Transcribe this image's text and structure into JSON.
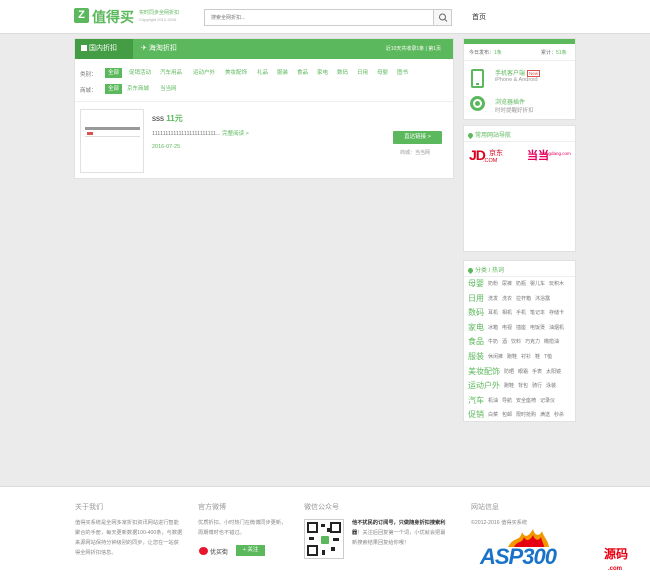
{
  "header": {
    "logo_letter": "Z",
    "logo_text": "值得买",
    "slogan": "实时同步全网折扣",
    "url": "Copyright 2012-2016",
    "search_placeholder": "搜索全网折扣...",
    "home": "首页"
  },
  "tabs": {
    "domestic": "国内折扣",
    "overseas": "海淘折扣",
    "meta": "近10天共收录1条 | 第1页"
  },
  "filters": {
    "category_label": "类别：",
    "categories": [
      "全部",
      "促销活动",
      "汽车用品",
      "运动户外",
      "美妆配饰",
      "礼品",
      "服装",
      "食品",
      "家电",
      "数码",
      "日用",
      "母婴",
      "图书"
    ],
    "mall_label": "商城：",
    "malls": [
      "全部",
      "京东商城",
      "当当网"
    ]
  },
  "item": {
    "title": "sss",
    "price": "11元",
    "desc": "111111111111111111111111...",
    "more": "完整阅读 >",
    "date": "2016-07-25",
    "buy": "直达链接 >",
    "mall": "商城：当当网"
  },
  "sidebar": {
    "stat_today": "今日发布：",
    "stat_today_val": "1条",
    "stat_total": "累计：",
    "stat_total_val": "51条",
    "mobile_title": "手机客户端",
    "mobile_badge": "New",
    "mobile_sub": "iPhone & Android",
    "plugin_title": "浏览器插件",
    "plugin_sub": "时时提醒好折扣",
    "nav_heading": "常用网站导航",
    "jd_logo": "JD",
    "jd_cn": "京东",
    "jd_sub": ".COM",
    "dd_logo": "当当",
    "dd_sub": "dangdang.com",
    "cat_heading": "分类 / 热词",
    "cats": [
      {
        "name": "母婴",
        "subs": [
          "奶粉",
          "尿裤",
          "奶瓶",
          "婴儿车",
          "玩积木"
        ]
      },
      {
        "name": "日用",
        "subs": [
          "洗发",
          "洗衣",
          "拉杆箱",
          "沐浴露"
        ]
      },
      {
        "name": "数码",
        "subs": [
          "耳机",
          "相机",
          "手机",
          "笔记本",
          "存储卡"
        ]
      },
      {
        "name": "家电",
        "subs": [
          "冰箱",
          "电视",
          "插座",
          "电饭煲",
          "油烟机"
        ]
      },
      {
        "name": "食品",
        "subs": [
          "牛奶",
          "酒",
          "饮料",
          "巧克力",
          "橄榄油"
        ]
      },
      {
        "name": "服装",
        "subs": [
          "休闲裤",
          "跑鞋",
          "衬衫",
          "鞋",
          "T恤"
        ]
      },
      {
        "name": "美妆配饰",
        "subs": [
          "防晒",
          "眼霜",
          "手表",
          "太阳镜"
        ]
      },
      {
        "name": "运动户外",
        "subs": [
          "跑鞋",
          "背包",
          "骑行",
          "泳装"
        ]
      },
      {
        "name": "汽车",
        "subs": [
          "机油",
          "导航",
          "安全座椅",
          "记录仪"
        ]
      },
      {
        "name": "促销",
        "subs": [
          "白菜",
          "包邮",
          "限时抢购",
          "满送",
          "秒杀"
        ]
      }
    ]
  },
  "footer": {
    "about_h": "关于我们",
    "about_p": "值得买系统是全网多家折扣资讯网站进行智能聚合的手册，每天更新数据100-400条，与数据来源网站保持分钟级别的同步，让您在一站获得全网折扣信息。",
    "weibo_h": "官方微博",
    "weibo_p": "优质折扣、小时热门在微博同步更新，周期博时也不错过。",
    "weibo_name": "优买街",
    "weibo_follow": "+ 关注",
    "wechat_h": "微信公众号",
    "wechat_p1": "他不扰民的订阅号，只做",
    "wechat_p2": "随身折扣搜索利器",
    "wechat_p3": "！关注后回复第一个词，小优就会把最新搜索结果回复给你哦！",
    "site_h": "网站信息",
    "site_p": "©2012-2016 值得买系统"
  },
  "watermark": {
    "asp": "ASP300",
    "cn": "源码",
    "url": ".com"
  }
}
